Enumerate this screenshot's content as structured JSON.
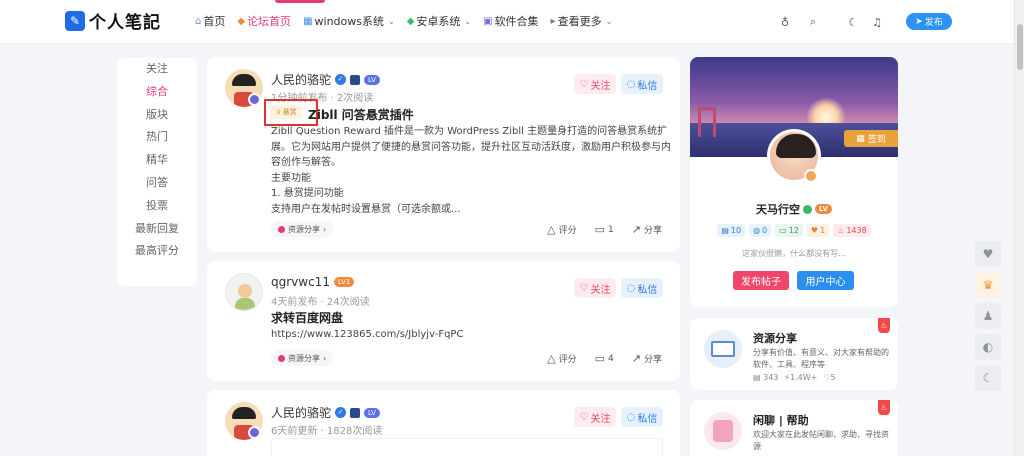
{
  "header": {
    "logo_text": "个人笔記",
    "nav": [
      {
        "label": "首页",
        "icon": "home-icon",
        "active": false
      },
      {
        "label": "论坛首页",
        "icon": "forum-icon",
        "active": true
      },
      {
        "label": "windows系统",
        "icon": "windows-icon",
        "dropdown": true
      },
      {
        "label": "安卓系统",
        "icon": "android-icon",
        "dropdown": true
      },
      {
        "label": "软件合集",
        "icon": "apps-icon"
      },
      {
        "label": "查看更多",
        "icon": "more-icon",
        "dropdown": true
      }
    ],
    "publish_label": "发布"
  },
  "left_menu": {
    "items": [
      "关注",
      "综合",
      "版块",
      "热门",
      "精华",
      "问答",
      "投票",
      "最新回复",
      "最高评分"
    ],
    "active_index": 1
  },
  "posts": [
    {
      "author": "人民的骆驼",
      "level": "LV",
      "meta": "1分钟前发布 · 2次阅读",
      "bounty_tag": "悬赏",
      "title": "Zibll 问答悬赏插件",
      "excerpt": "Zibll Question Reward 插件是一款为 WordPress Zibll 主题量身打造的问答悬赏系统扩展。它为网站用户提供了便捷的悬赏问答功能，提升社区互动活跃度，激励用户积极参与内容创作与解答。\n主要功能\n1. 悬赏提问功能\n支持用户在发帖时设置悬赏（可选余额或...",
      "category": "资源分享",
      "actions": {
        "rate": "评分",
        "comments": "1",
        "share": "分享"
      },
      "follow": "关注",
      "message": "私信"
    },
    {
      "author": "qgrvwc11",
      "level": "LV1",
      "meta": "4天前发布 · 24次阅读",
      "title": "求转百度网盘",
      "excerpt": "https://www.123865.com/s/Jblyjv-FqPC",
      "category": "资源分享",
      "actions": {
        "rate": "评分",
        "comments": "4",
        "share": "分享"
      },
      "follow": "关注",
      "message": "私信"
    },
    {
      "author": "人民的骆驼",
      "level": "LV",
      "meta": "6天前更新 · 1828次阅读",
      "follow": "关注",
      "message": "私信"
    }
  ],
  "profile": {
    "signin": "签到",
    "name": "天马行空",
    "level": "LV",
    "stats": [
      "10",
      "0",
      "12",
      "1",
      "1438"
    ],
    "bio": "这家伙很懒，什么都没有写...",
    "publish_btn": "发布帖子",
    "center_btn": "用户中心"
  },
  "forums": [
    {
      "title": "资源分享",
      "desc": "分享有价值、有意义、对大家有帮助的软件、工具、程序等",
      "stats": [
        "343",
        "1.4W+",
        "5"
      ]
    },
    {
      "title": "闲聊 | 帮助",
      "desc": "欢迎大家在此发帖闲聊、求助、寻找资源"
    }
  ],
  "colors": {
    "accent": "#e5397e",
    "primary": "#2c92f5"
  }
}
